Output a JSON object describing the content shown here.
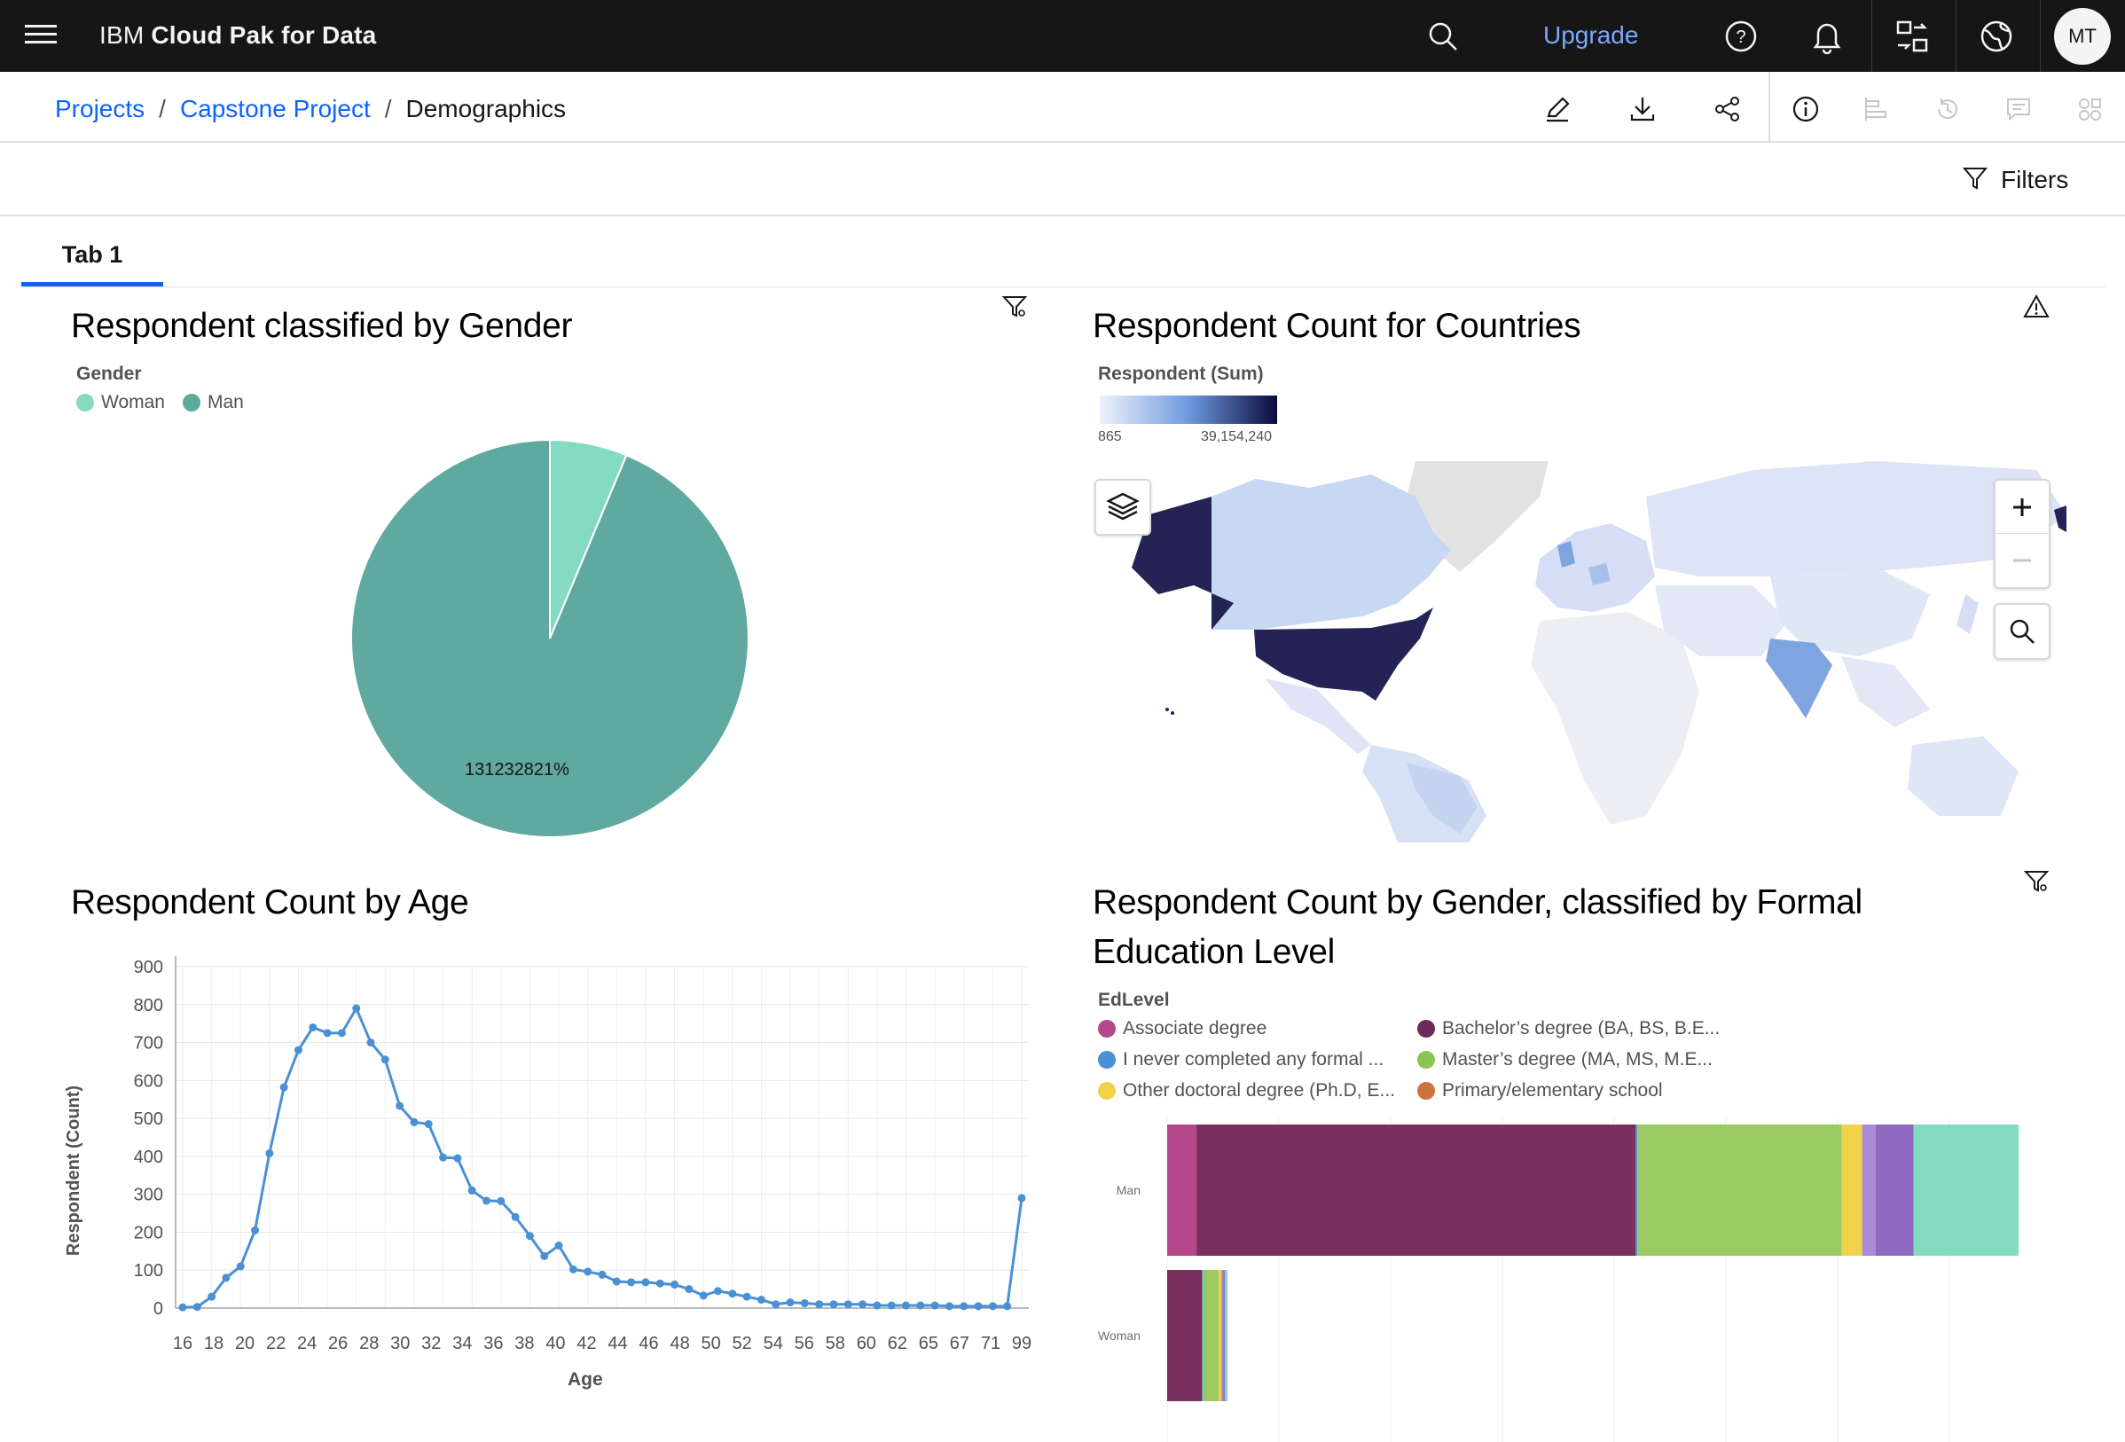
{
  "topbar": {
    "brand_prefix": "IBM",
    "brand_name": "Cloud Pak for Data",
    "upgrade_label": "Upgrade",
    "avatar_initials": "MT"
  },
  "breadcrumb": {
    "items": [
      "Projects",
      "Capstone Project",
      "Demographics"
    ]
  },
  "toolbar": {
    "filters_label": "Filters"
  },
  "tabs": [
    {
      "label": "Tab 1"
    }
  ],
  "widgets": {
    "gender": {
      "title": "Respondent classified by Gender",
      "legend_title": "Gender",
      "legend": [
        {
          "label": "Woman",
          "color": "#84dbc1"
        },
        {
          "label": "Man",
          "color": "#5fa9a0"
        }
      ],
      "slice_label": "131232821%"
    },
    "countries": {
      "title": "Respondent Count for Countries",
      "legend_title": "Respondent (Sum)",
      "scale_min": "865",
      "scale_max": "39,154,240"
    },
    "age": {
      "title": "Respondent Count by Age",
      "xlabel": "Age",
      "ylabel": "Respondent (Count)"
    },
    "education": {
      "title_line1": "Respondent Count by Gender, classified by Formal",
      "title_line2": "Education Level",
      "legend_title": "EdLevel",
      "legend": [
        {
          "label": "Associate degree",
          "color": "#b5488a"
        },
        {
          "label": "Bachelor’s degree (BA, BS, B.E...",
          "color": "#6e2a58"
        },
        {
          "label": "I never completed any formal ...",
          "color": "#4a90d4"
        },
        {
          "label": "Master’s degree (MA, MS, M.E...",
          "color": "#8cc54f"
        },
        {
          "label": "Other doctoral degree (Ph.D, E...",
          "color": "#f2d14b"
        },
        {
          "label": "Primary/elementary school",
          "color": "#c8743a"
        }
      ],
      "categories": [
        "Man",
        "Woman"
      ]
    }
  },
  "chart_data": [
    {
      "type": "pie",
      "title": "Respondent classified by Gender",
      "categories": [
        "Woman",
        "Man"
      ],
      "values": [
        6.3,
        93.7
      ],
      "legend_placement": "top-left"
    },
    {
      "type": "line",
      "title": "Respondent Count by Age",
      "xlabel": "Age",
      "ylabel": "Respondent (Count)",
      "ylim": [
        0,
        900
      ],
      "yticks": [
        0,
        100,
        200,
        300,
        400,
        500,
        600,
        700,
        800,
        900
      ],
      "xticks": [
        "16",
        "18",
        "20",
        "22",
        "24",
        "26",
        "28",
        "30",
        "32",
        "34",
        "36",
        "38",
        "40",
        "42",
        "44",
        "46",
        "48",
        "50",
        "52",
        "54",
        "56",
        "58",
        "60",
        "62",
        "65",
        "67",
        "71",
        "99"
      ],
      "grid": true,
      "color": "#4a90d4",
      "series": [
        {
          "values": [
            2,
            3,
            30,
            80,
            110,
            205,
            408,
            582,
            680,
            740,
            725,
            725,
            790,
            700,
            655,
            533,
            490,
            485,
            397,
            395,
            310,
            283,
            282,
            240,
            190,
            137,
            165,
            102,
            96,
            88,
            70,
            68,
            68,
            65,
            62,
            50,
            33,
            45,
            38,
            30,
            22,
            10,
            15,
            13,
            10,
            10,
            10,
            10,
            7,
            7,
            7,
            7,
            7,
            5,
            5,
            5,
            5,
            5,
            290
          ]
        }
      ]
    },
    {
      "type": "bar",
      "title": "Respondent Count by Gender, classified by Formal Education Level",
      "orientation": "horizontal",
      "stacked": true,
      "categories": [
        "Man",
        "Woman"
      ],
      "series": [
        {
          "name": "Associate degree",
          "color": "#b5488a",
          "values": [
            33,
            0
          ]
        },
        {
          "name": "Bachelor’s degree (BA, BS, B.E...",
          "color": "#7a2f5c",
          "values": [
            494,
            39
          ]
        },
        {
          "name": "I never completed any formal ...",
          "color": "#4a90d4",
          "values": [
            2,
            1
          ]
        },
        {
          "name": "Master’s degree (MA, MS, M.E...",
          "color": "#9bca63",
          "values": [
            230,
            18
          ]
        },
        {
          "name": "Other doctoral degree (Ph.D, E...",
          "color": "#f2d14b",
          "values": [
            23,
            3
          ]
        },
        {
          "name": "",
          "color": "#a98bd6",
          "values": [
            15,
            2
          ]
        },
        {
          "name": "",
          "color": "#8e6bc0",
          "values": [
            43,
            2
          ]
        },
        {
          "name": "",
          "color": "#84dbc1",
          "values": [
            118,
            3
          ]
        }
      ]
    }
  ]
}
